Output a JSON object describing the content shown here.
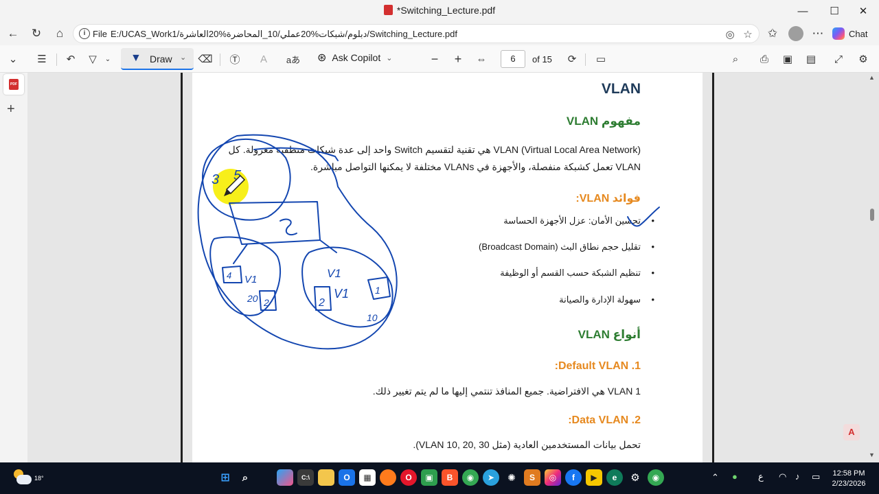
{
  "window": {
    "title": "*Switching_Lecture.pdf",
    "controls": {
      "minimize": "—",
      "maximize": "☐",
      "close": "✕"
    }
  },
  "addressbar": {
    "scheme": "File",
    "url": "E:/UCAS_Work1/دبلوم/شبكات%20عملي/10_المحاضرة%20العاشرة/Switching_Lecture.pdf",
    "chat_label": "Chat"
  },
  "pdf_toolbar": {
    "draw_label": "Draw",
    "ask_copilot_label": "Ask Copilot",
    "page_number": "6",
    "page_of": "of 15",
    "text_icon_label": "aあ"
  },
  "document": {
    "title": "VLAN",
    "concept_heading": "مفهوم VLAN",
    "concept_line1": "VLAN (Virtual Local Area Network) هي تقنية لتقسيم Switch واحد إلى عدة شبكات منطقية معزولة. كل",
    "concept_line2": "VLAN تعمل كشبكة منفصلة، والأجهزة في VLANs مختلفة لا يمكنها التواصل مباشرة.",
    "benefits_heading": "فوائد VLAN:",
    "benefits": [
      "تحسين الأمان: عزل الأجهزة الحساسة",
      "تقليل حجم نطاق البث (Broadcast Domain)",
      "تنظيم الشبكة حسب القسم أو الوظيفة",
      "سهولة الإدارة والصيانة"
    ],
    "types_heading": "أنواع VLAN",
    "type1_heading": "1. Default VLAN:",
    "type1_text": "VLAN 1 هي الافتراضية. جميع المنافذ تنتمي إليها ما لم يتم تغيير ذلك.",
    "type2_heading": "2. Data VLAN:",
    "type2_text": "تحمل بيانات المستخدمين العادية (مثل VLAN 10, 20, 30)."
  },
  "ink_annotations": {
    "labels": [
      "3",
      "5",
      "4",
      "V1",
      "20",
      "2",
      "V1",
      "2",
      "V1",
      "1",
      "10"
    ],
    "color": "#1346b0"
  },
  "taskbar": {
    "temperature": "18°",
    "ime": "ع",
    "time": "12:58 PM",
    "date": "2/23/2026"
  },
  "colors": {
    "title_navy": "#1f3b5a",
    "heading_green": "#2e7d32",
    "heading_orange": "#e6891f",
    "ink_blue": "#1346b0",
    "highlight_yellow": "#f7ef1a"
  }
}
